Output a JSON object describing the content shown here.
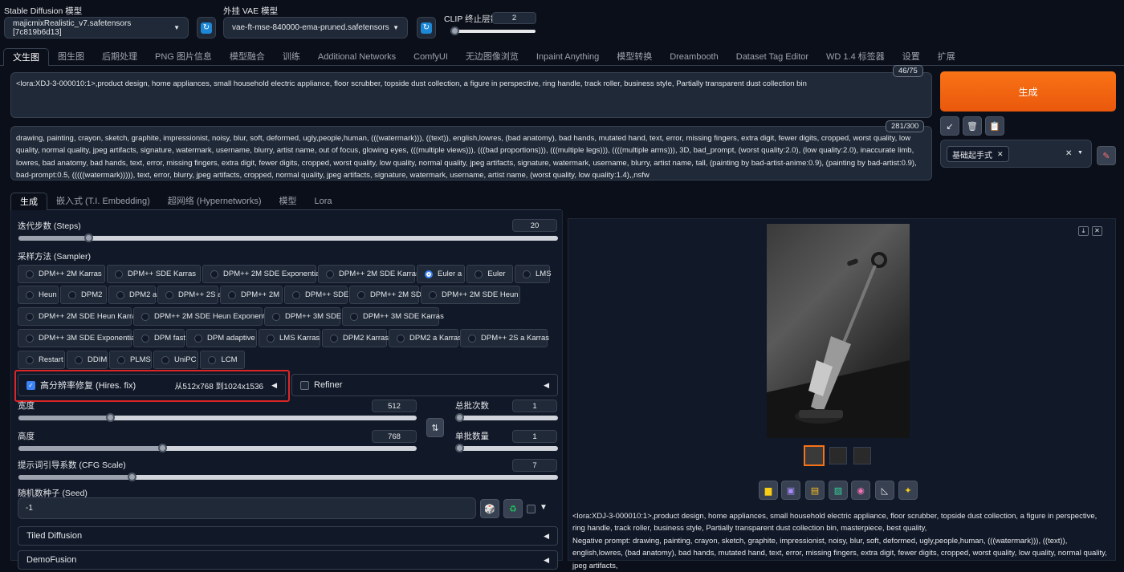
{
  "header": {
    "sd_model_label": "Stable Diffusion 模型",
    "sd_model_value": "majicmixRealistic_v7.safetensors [7c819b6d13]",
    "vae_label": "外挂 VAE 模型",
    "vae_value": "vae-ft-mse-840000-ema-pruned.safetensors",
    "clip_label": "CLIP 终止层数",
    "clip_value": "2",
    "clip_slider_fraction": 0.05
  },
  "main_tabs": [
    "文生图",
    "图生图",
    "后期处理",
    "PNG 图片信息",
    "模型融合",
    "训练",
    "Additional Networks",
    "ComfyUI",
    "无边图像浏览",
    "Inpaint Anything",
    "模型转换",
    "Dreambooth",
    "Dataset Tag Editor",
    "WD 1.4 标签器",
    "设置",
    "扩展"
  ],
  "prompt": {
    "text": "<lora:XDJ-3-000010:1>,product design, home appliances, small household electric appliance, floor scrubber, topside dust collection, a figure in perspective, ring handle, track roller, business style, Partially transparent dust collection bin",
    "token_count": "46/75"
  },
  "negative_prompt": {
    "text": "drawing, painting, crayon, sketch, graphite, impressionist, noisy, blur, soft, deformed, ugly,people,human, (((watermark))), ((text)), english,lowres, (bad anatomy), bad hands, mutated hand, text, error, missing fingers, extra digit, fewer digits, cropped, worst quality, low quality, normal quality, jpeg artifacts, signature, watermark, username, blurry, artist name, out of focus, glowing eyes, (((multiple views))), (((bad proportions))), (((multiple legs))), ((((multiple arms))), 3D, bad_prompt, (worst quality:2.0), (low quality:2.0), inaccurate limb, lowres, bad anatomy, bad hands, text, error, missing fingers, extra digit, fewer digits, cropped, worst quality, low quality, normal quality, jpeg artifacts, signature, watermark, username, blurry, artist name, tall, (painting by bad-artist-anime:0.9), (painting by bad-artist:0.9), bad-prompt:0.5, (((((watermark))))), text, error, blurry, jpeg artifacts, cropped, normal quality, jpeg artifacts, signature, watermark, username, artist name, (worst quality, low quality:1.4),,nsfw",
    "token_count": "281/300"
  },
  "generate": {
    "label": "生成",
    "style_chip": "基础起手式",
    "accent": "#f97316"
  },
  "sub_tabs": [
    "生成",
    "嵌入式 (T.I. Embedding)",
    "超网络 (Hypernetworks)",
    "模型",
    "Lora"
  ],
  "steps": {
    "label": "迭代步数 (Steps)",
    "value": "20",
    "fraction": 0.13
  },
  "sampler": {
    "label": "采样方法 (Sampler)",
    "selected": "Euler a",
    "rows": [
      [
        "DPM++ 2M Karras",
        "DPM++ SDE Karras",
        "DPM++ 2M SDE Exponential",
        "DPM++ 2M SDE Karras",
        "Euler a",
        "Euler",
        "LMS"
      ],
      [
        "Heun",
        "DPM2",
        "DPM2 a",
        "DPM++ 2S a",
        "DPM++ 2M",
        "DPM++ SDE",
        "DPM++ 2M SDE",
        "DPM++ 2M SDE Heun"
      ],
      [
        "DPM++ 2M SDE Heun Karras",
        "DPM++ 2M SDE Heun Exponential",
        "DPM++ 3M SDE",
        "DPM++ 3M SDE Karras"
      ],
      [
        "DPM++ 3M SDE Exponential",
        "DPM fast",
        "DPM adaptive",
        "LMS Karras",
        "DPM2 Karras",
        "DPM2 a Karras",
        "DPM++ 2S a Karras"
      ],
      [
        "Restart",
        "DDIM",
        "PLMS",
        "UniPC",
        "LCM"
      ]
    ]
  },
  "hires": {
    "label": "高分辨率修复 (Hires. fix)",
    "info": "从512x768 到1024x1536",
    "checked": true
  },
  "refiner": {
    "label": "Refiner"
  },
  "width": {
    "label": "宽度",
    "value": "512",
    "fraction": 0.23
  },
  "height": {
    "label": "高度",
    "value": "768",
    "fraction": 0.36
  },
  "batch_count": {
    "label": "总批次数",
    "value": "1",
    "fraction": 0.0
  },
  "batch_size": {
    "label": "单批数量",
    "value": "1",
    "fraction": 0.0
  },
  "swap_icon": "swap-icon",
  "cfg": {
    "label": "提示词引导系数 (CFG Scale)",
    "value": "7",
    "fraction": 0.21
  },
  "seed": {
    "label": "随机数种子 (Seed)",
    "value": "-1"
  },
  "accordions": {
    "tiled": "Tiled Diffusion",
    "demo": "DemoFusion"
  },
  "output": {
    "info_prompt": "<lora:XDJ-3-000010:1>,product design, home appliances, small household electric appliance, floor scrubber, topside dust collection, a figure in perspective, ring handle, track roller, business style, Partially transparent dust collection bin, masterpiece, best quality,",
    "info_negative": "Negative prompt: drawing, painting, crayon, sketch, graphite, impressionist, noisy, blur, soft, deformed, ugly,people,human, (((watermark))), ((text)), english,lowres, (bad anatomy), bad hands, mutated hand, text, error, missing fingers, extra digit, fewer digits, cropped, worst quality, low quality, normal quality, jpeg artifacts,",
    "tools": [
      "folder-icon",
      "save-icon",
      "zip-icon",
      "image-send-icon",
      "palette-icon",
      "ruler-icon",
      "sparkle-icon"
    ]
  }
}
